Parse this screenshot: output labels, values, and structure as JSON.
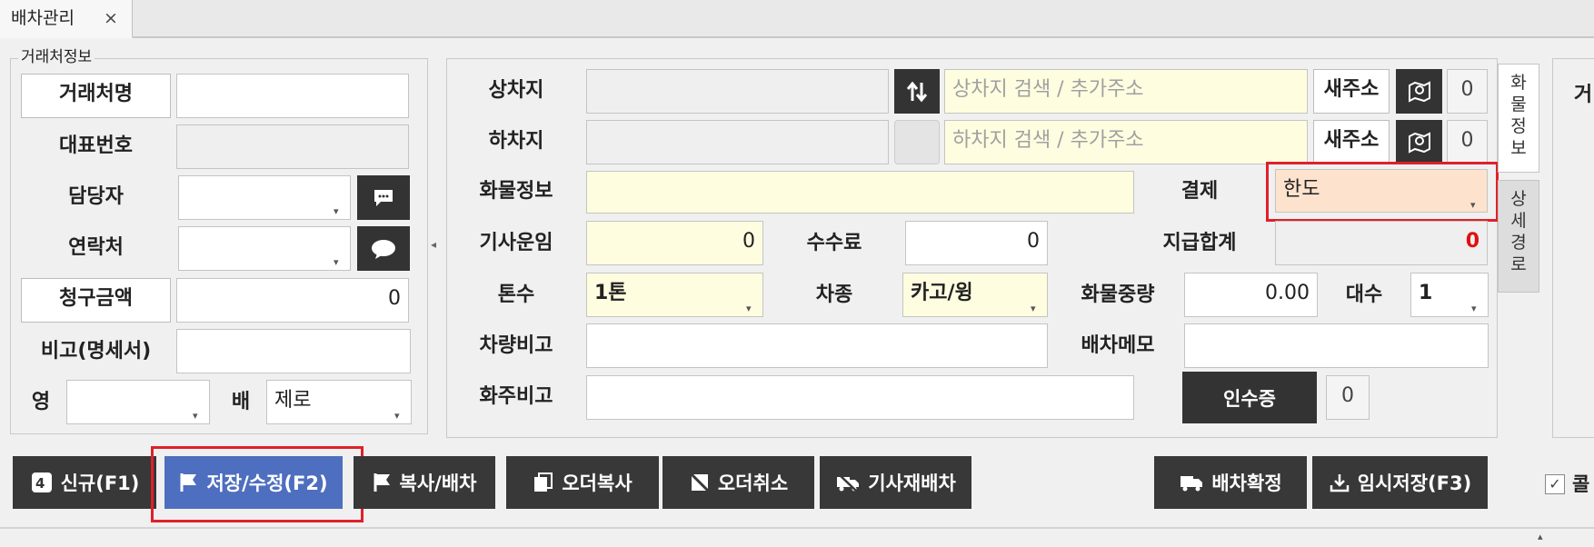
{
  "tab": {
    "title": "배차관리",
    "close": "×"
  },
  "left_panel": {
    "legend": "거래처정보",
    "client_name_label": "거래처명",
    "client_name_value": "",
    "rep_number_label": "대표번호",
    "rep_number_value": "",
    "manager_label": "담당자",
    "contact_label": "연락처",
    "billing_label": "청구금액",
    "billing_value": "0",
    "remark_label": "비고(명세서)",
    "sales_label": "영",
    "dispatch_label": "배",
    "dispatch_value": "제로"
  },
  "main_panel": {
    "loading_label": "상차지",
    "loading_search_placeholder": "상차지 검색 / 추가주소",
    "unloading_label": "하차지",
    "unloading_search_placeholder": "하차지 검색 / 추가주소",
    "new_address_label": "새주소",
    "loading_count": "0",
    "unloading_count": "0",
    "cargo_label": "화물정보",
    "payment_label": "결제",
    "payment_value": "한도",
    "driver_fare_label": "기사운임",
    "driver_fare_value": "0",
    "fee_label": "수수료",
    "fee_value": "0",
    "payout_total_label": "지급합계",
    "payout_total_value": "0",
    "tonnage_label": "톤수",
    "tonnage_value": "1톤",
    "vehicle_type_label": "차종",
    "vehicle_type_value": "카고/윙",
    "cargo_weight_label": "화물중량",
    "cargo_weight_value": "0.00",
    "units_label": "대수",
    "units_value": "1",
    "vehicle_remark_label": "차량비고",
    "dispatch_memo_label": "배차메모",
    "shipper_remark_label": "화주비고",
    "receipt_button": "인수증",
    "receipt_count": "0",
    "side_tab_cargo": "화물정보",
    "side_tab_route": "상세경로",
    "right_cutoff_label": "거"
  },
  "toolbar": {
    "new": "신규(F1)",
    "save": "저장/수정(F2)",
    "copy_dispatch": "복사/배차",
    "order_copy": "오더복사",
    "order_cancel": "오더취소",
    "driver_redispatch": "기사재배차",
    "confirm_dispatch": "배차확정",
    "temp_save": "임시저장(F3)",
    "right_checkbox_label": "콜"
  },
  "colors": {
    "dark_button": "#383838",
    "save_button": "#4e6fbf",
    "highlight": "#e0202a",
    "payment_field": "#fde3cd",
    "total_value": "#e01010"
  }
}
